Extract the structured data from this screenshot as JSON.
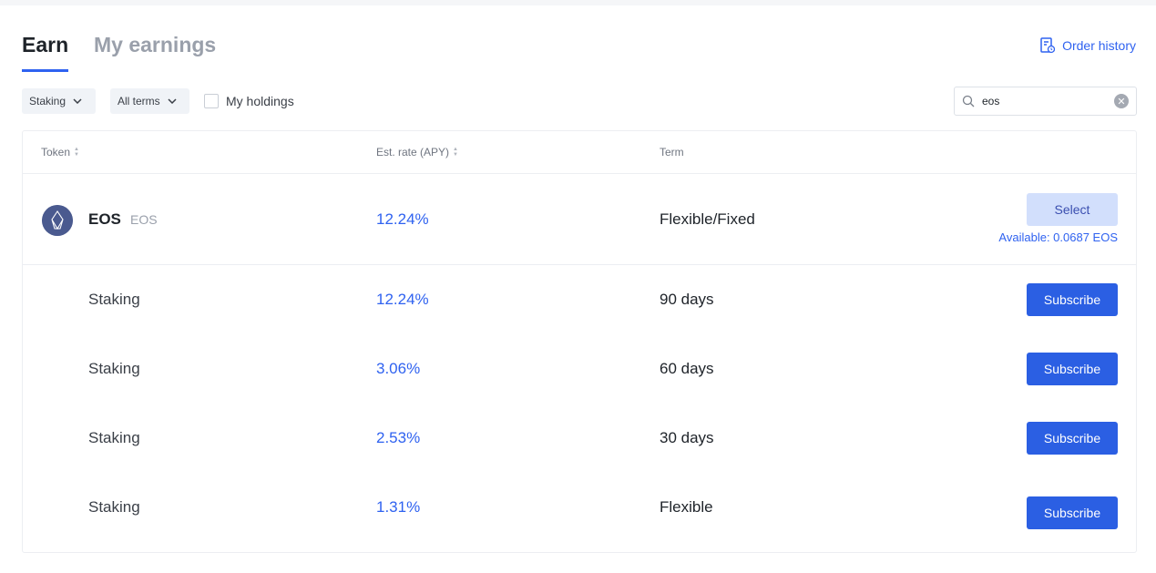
{
  "tabs": [
    {
      "label": "Earn",
      "active": true
    },
    {
      "label": "My earnings",
      "active": false
    }
  ],
  "order_history": "Order history",
  "filters": {
    "product": "Staking",
    "term": "All terms",
    "holdings_label": "My holdings",
    "holdings_checked": false
  },
  "search": {
    "value": "eos"
  },
  "table": {
    "headers": {
      "token": "Token",
      "rate": "Est. rate (APY)",
      "term": "Term"
    },
    "token": {
      "name": "EOS",
      "symbol": "EOS",
      "rate": "12.24%",
      "term": "Flexible/Fixed",
      "action": "Select",
      "available": "Available: 0.0687 EOS"
    },
    "rows": [
      {
        "type": "Staking",
        "rate": "12.24%",
        "term": "90 days",
        "action": "Subscribe"
      },
      {
        "type": "Staking",
        "rate": "3.06%",
        "term": "60 days",
        "action": "Subscribe"
      },
      {
        "type": "Staking",
        "rate": "2.53%",
        "term": "30 days",
        "action": "Subscribe"
      },
      {
        "type": "Staking",
        "rate": "1.31%",
        "term": "Flexible",
        "action": "Subscribe"
      }
    ]
  },
  "colors": {
    "accent": "#2f62f0",
    "button": "#2b5fe3"
  }
}
